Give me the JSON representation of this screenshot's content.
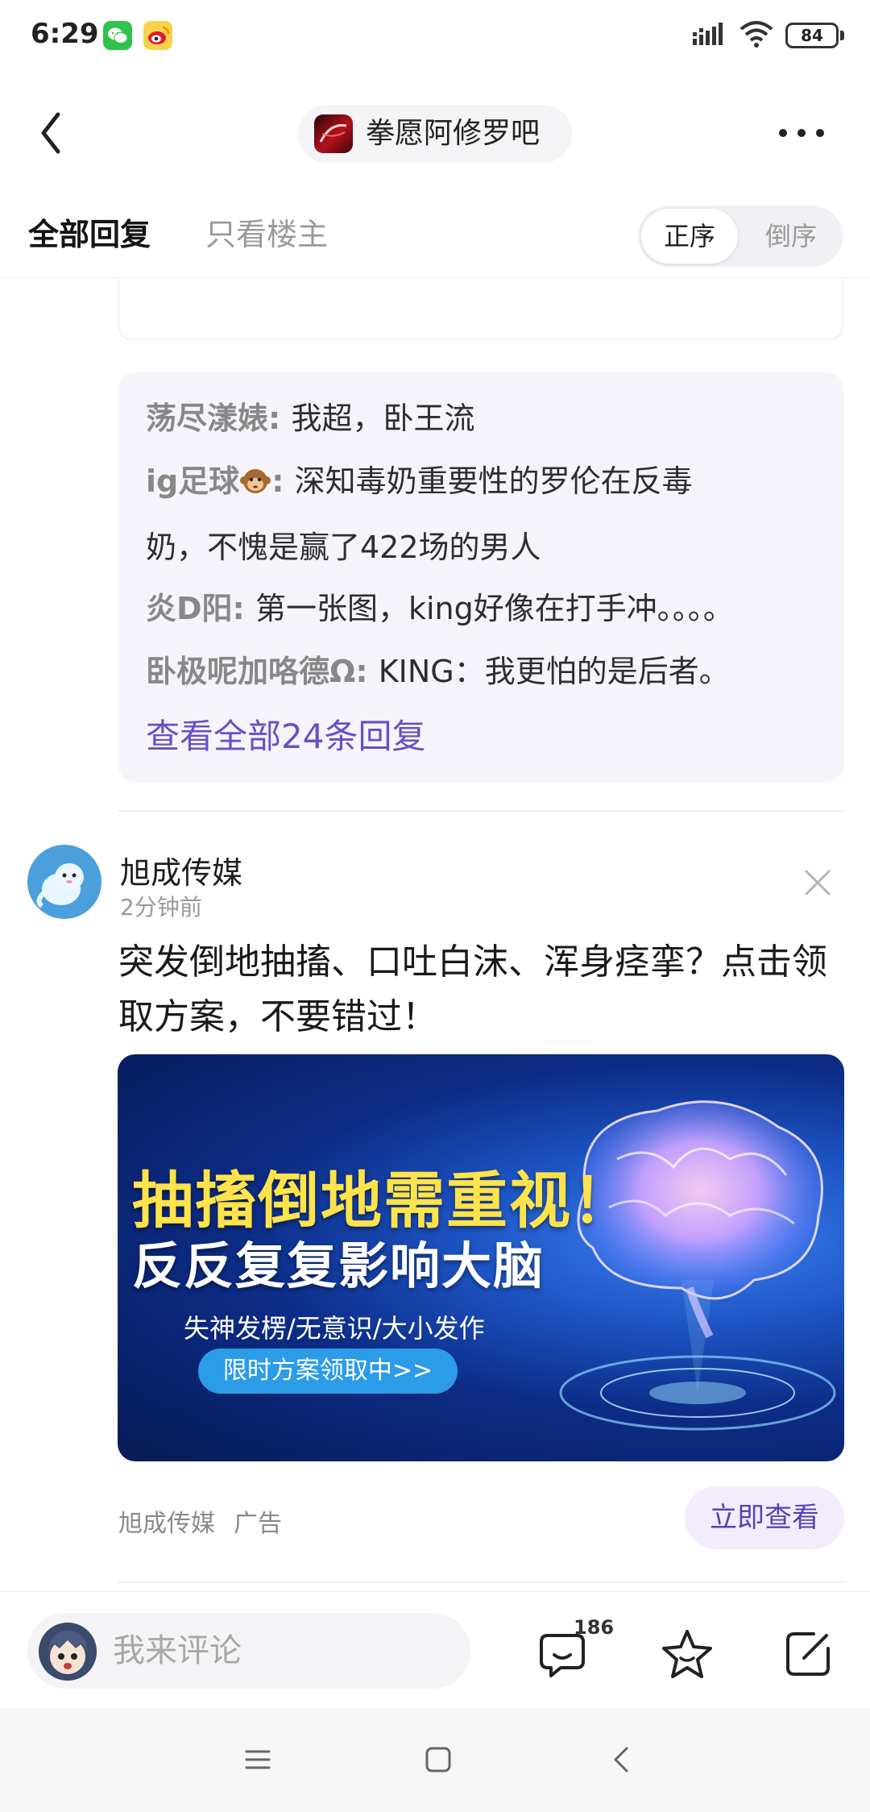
{
  "status_bar": {
    "time": "6:29",
    "battery": "84",
    "icons": [
      "wechat-icon",
      "weibo-icon",
      "signal-icon",
      "wifi-icon",
      "battery-icon"
    ]
  },
  "nav": {
    "forum_name": "拳愿阿修罗吧",
    "icons": [
      "back-icon",
      "forum-logo",
      "more-icon"
    ]
  },
  "tabs": {
    "all_replies": "全部回复",
    "only_op": "只看楼主",
    "sort_asc": "正序",
    "sort_desc": "倒序"
  },
  "replies": {
    "items": [
      {
        "name": "荡尽漾婊",
        "text": "我超，卧王流"
      },
      {
        "name": "ig足球",
        "text": "深知毒奶重要性的罗伦在反毒",
        "continuation": "奶，不愧是赢了422场的男人"
      },
      {
        "name": "炎D阳",
        "text": "第一张图，king好像在打手冲。。。。"
      },
      {
        "name": "卧极呢加咯德Ω",
        "text": "KING：我更怕的是后者。"
      }
    ],
    "separator": ": ",
    "view_all": "查看全部24条回复"
  },
  "ad": {
    "author": "旭成传媒",
    "time": "2分钟前",
    "title": "突发倒地抽搐、口吐白沫、浑身痉挛？点击领取方案，不要错过！",
    "banner": {
      "headline": "抽搐倒地需重视！",
      "subhead": "反反复复影响大脑",
      "symptoms": "失神发楞/无意识/大小发作",
      "cta": "限时方案领取中>>"
    },
    "footer_source": "旭成传媒",
    "footer_label": "广告",
    "view_button": "立即查看"
  },
  "comment_bar": {
    "placeholder": "我来评论",
    "reply_count": "186",
    "icons": [
      "comment-icon",
      "star-icon",
      "edit-icon"
    ]
  },
  "system_nav": {
    "icons": [
      "menu-icon",
      "home-icon",
      "back-icon"
    ]
  },
  "colors": {
    "accent": "#6a4fc6",
    "reply_bg": "#f5f4fa",
    "view_button_bg": "#f2ecfc",
    "banner_yellow": "#ffe34a",
    "cta_blue": "#2c9be8"
  }
}
